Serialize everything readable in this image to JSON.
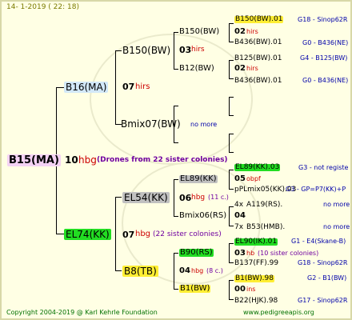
{
  "header": {
    "date": "14-  1-2019  (  22:  18)"
  },
  "footer": {
    "copyright": "Copyright 2004-2019 @ Karl Kehrle Foundation",
    "url": "www.pedigreeapis.org"
  },
  "root": {
    "name": "B15(MA)",
    "year": "10",
    "mark": "hbg",
    "note": "(Drones from 22 sister colonies)"
  },
  "sire": {
    "name": "B16(MA)",
    "year": "07",
    "mark": "hirs",
    "sire": {
      "name": "B150(BW)",
      "year": "03",
      "mark": "hirs",
      "sire": {
        "name": "B150(BW)",
        "year": "02",
        "mark": "hirs",
        "sire": {
          "name": "B150(BW).01",
          "ref": "G18 - Sinop62R"
        },
        "dam": {
          "name": "B436(BW).01",
          "ref": "G0 - B436(NE)"
        }
      },
      "dam": {
        "name": "B12(BW)",
        "year": "02",
        "mark": "hirs",
        "sire": {
          "name": "B125(BW).01",
          "ref": "G4 - B125(BW)"
        },
        "dam": {
          "name": "B436(BW).01",
          "ref": "G0 - B436(NE)"
        }
      }
    },
    "dam": {
      "name": "Bmix07(BW)",
      "more": "no more"
    }
  },
  "dam": {
    "name": "EL74(KK)",
    "year": "07",
    "mark": "hbg",
    "note": "(22 sister colonies)",
    "sire": {
      "name": "EL54(KK)",
      "year": "06",
      "mark": "hbg",
      "note": "(11 c.)",
      "sire": {
        "name": "EL89(KK)",
        "year": "05",
        "mark": "obpf",
        "sire": {
          "name": "EL89(KK).03",
          "ref": "G3 - not registe"
        },
        "dam": {
          "name": "pPLmix05(KK).03",
          "ref": "G3 - GP=P7(KK)+P"
        }
      },
      "dam": {
        "name": "Bmix06(RS)",
        "year": "04",
        "prefix1": "4x",
        "prefix2": "7x",
        "sire": {
          "name": "A119(RS).",
          "ref": "no more"
        },
        "dam": {
          "name": "B53(HMB).",
          "ref": "no more"
        }
      }
    },
    "dam": {
      "name": "B8(TB)",
      "sire": {
        "name": "B90(RS)",
        "year": "04",
        "mark": "hbg",
        "note": "(8 c.)",
        "sire": {
          "name": "EL90(IK).01",
          "ref": "G1 - E4(Skane-B)"
        },
        "dam": {
          "name": "B137(FF).99",
          "ref": "G18 - Sinop62R"
        },
        "top": {
          "year": "03",
          "mark": "hb",
          "note": "(10 sister colonies)"
        }
      },
      "dam": {
        "name": "B1(BW)",
        "year": "00",
        "mark": "ins",
        "sire": {
          "name": "B1(BW).98",
          "ref": "G2 - B1(BW)"
        },
        "dam": {
          "name": "B22(HJK).98",
          "ref": "G17 - Sinop62R"
        }
      }
    }
  },
  "colors": {
    "root_bg": "#f4d2f4",
    "sire_bg": "#d2e8f8",
    "green": "#22dd22",
    "yellow": "#ffee33",
    "grey": "#c0c0c0",
    "mark_red": "#cc0000",
    "ref_blue": "#0000aa",
    "footer_green": "#007000"
  }
}
